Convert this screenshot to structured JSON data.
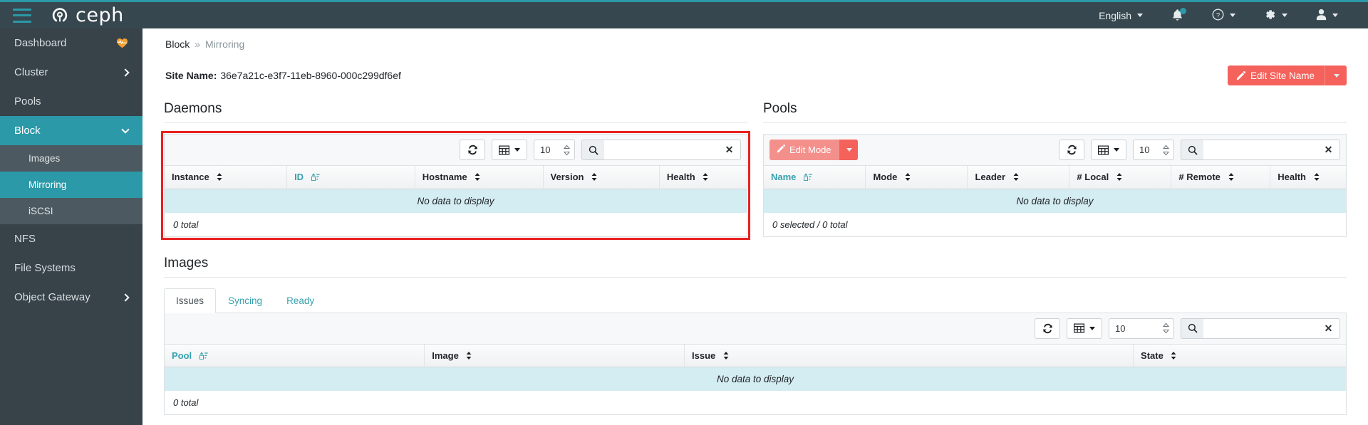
{
  "topbar": {
    "brand": "ceph",
    "brand_icon": "ceph-logo-icon",
    "menu_icon": "hamburger-icon",
    "language": "English",
    "notifications_icon": "bell-icon",
    "help_icon": "question-circle-icon",
    "settings_icon": "gear-icon",
    "user_icon": "user-icon"
  },
  "sidebar": {
    "items": [
      {
        "label": "Dashboard",
        "icon": "heartbeat-icon",
        "expandable": false,
        "active": false
      },
      {
        "label": "Cluster",
        "icon": "chevron-right-icon",
        "expandable": true,
        "active": false
      },
      {
        "label": "Pools",
        "icon": "",
        "expandable": false,
        "active": false
      },
      {
        "label": "Block",
        "icon": "chevron-down-icon",
        "expandable": true,
        "active": true
      },
      {
        "label": "NFS",
        "icon": "",
        "expandable": false,
        "active": false
      },
      {
        "label": "File Systems",
        "icon": "",
        "expandable": false,
        "active": false
      },
      {
        "label": "Object Gateway",
        "icon": "chevron-right-icon",
        "expandable": true,
        "active": false
      }
    ],
    "block_children": [
      {
        "label": "Images",
        "active": false
      },
      {
        "label": "Mirroring",
        "active": true
      },
      {
        "label": "iSCSI",
        "active": false
      }
    ]
  },
  "breadcrumb": {
    "root": "Block",
    "separator": "»",
    "current": "Mirroring"
  },
  "site": {
    "label": "Site Name:",
    "value": "36e7a21c-e3f7-11eb-8960-000c299df6ef",
    "edit_button": "Edit Site Name",
    "edit_icon": "pencil-icon",
    "edit_caret_icon": "caret-down-icon",
    "accent_color": "#f4625b"
  },
  "daemons": {
    "title": "Daemons",
    "highlighted": true,
    "highlight_color": "#e8201f",
    "toolbar": {
      "refresh_icon": "refresh-icon",
      "columns_icon": "table-columns-icon",
      "columns_caret_icon": "caret-down-icon",
      "page_size": "10",
      "search_icon": "search-icon",
      "search_value": "",
      "search_placeholder": "",
      "clear_icon": "close-icon"
    },
    "columns": [
      {
        "label": "Instance",
        "sorted": false
      },
      {
        "label": "ID",
        "sorted": true
      },
      {
        "label": "Hostname",
        "sorted": false
      },
      {
        "label": "Version",
        "sorted": false
      },
      {
        "label": "Health",
        "sorted": false
      }
    ],
    "empty_message": "No data to display",
    "footer": "0 total"
  },
  "pools": {
    "title": "Pools",
    "toolbar": {
      "edit_mode_label": "Edit Mode",
      "edit_mode_icon": "pencil-icon",
      "edit_mode_caret_icon": "caret-down-icon",
      "refresh_icon": "refresh-icon",
      "columns_icon": "table-columns-icon",
      "columns_caret_icon": "caret-down-icon",
      "page_size": "10",
      "search_icon": "search-icon",
      "search_value": "",
      "search_placeholder": "",
      "clear_icon": "close-icon"
    },
    "columns": [
      {
        "label": "Name",
        "sorted": true
      },
      {
        "label": "Mode",
        "sorted": false
      },
      {
        "label": "Leader",
        "sorted": false
      },
      {
        "label": "# Local",
        "sorted": false
      },
      {
        "label": "# Remote",
        "sorted": false
      },
      {
        "label": "Health",
        "sorted": false
      }
    ],
    "empty_message": "No data to display",
    "footer": "0 selected / 0 total"
  },
  "images": {
    "title": "Images",
    "tabs": [
      {
        "label": "Issues",
        "active": true
      },
      {
        "label": "Syncing",
        "active": false
      },
      {
        "label": "Ready",
        "active": false
      }
    ],
    "toolbar": {
      "refresh_icon": "refresh-icon",
      "columns_icon": "table-columns-icon",
      "columns_caret_icon": "caret-down-icon",
      "page_size": "10",
      "search_icon": "search-icon",
      "search_value": "",
      "search_placeholder": "",
      "clear_icon": "close-icon"
    },
    "columns": [
      {
        "label": "Pool",
        "sorted": true
      },
      {
        "label": "Image",
        "sorted": false
      },
      {
        "label": "Issue",
        "sorted": false
      },
      {
        "label": "State",
        "sorted": false
      }
    ],
    "empty_message": "No data to display",
    "footer": "0 total"
  }
}
